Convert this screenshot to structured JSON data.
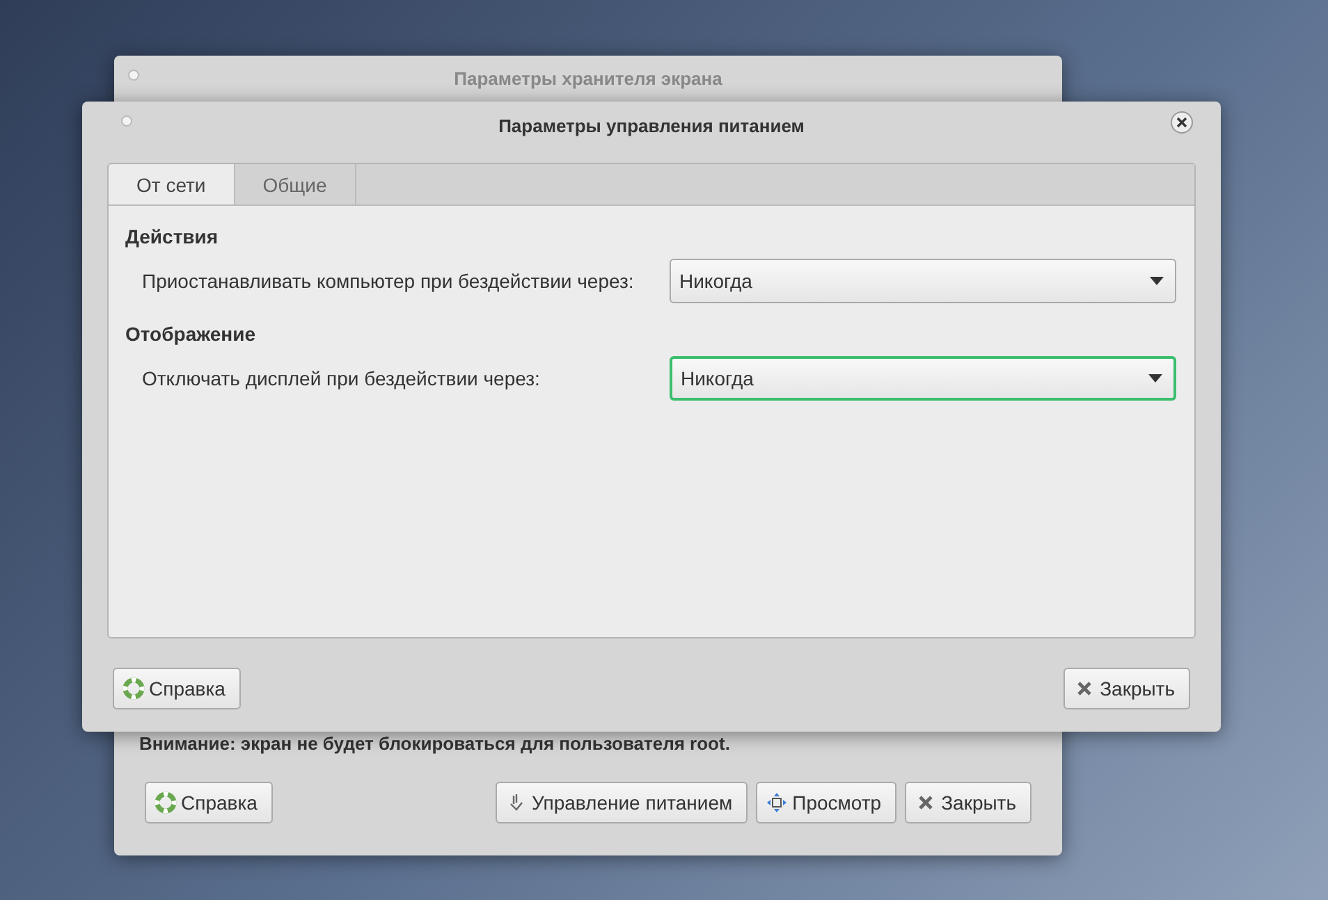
{
  "background_window": {
    "title": "Параметры хранителя экрана",
    "warning": "Внимание: экран не будет блокироваться для пользователя root.",
    "buttons": [
      {
        "label": "Справка",
        "kind": "help"
      },
      {
        "label": "Управление питанием",
        "kind": "power"
      },
      {
        "label": "Просмотр",
        "kind": "preview"
      },
      {
        "label": "Закрыть",
        "kind": "close"
      }
    ]
  },
  "window": {
    "title": "Параметры управления питанием",
    "tabs": [
      {
        "label": "От сети",
        "selected": true
      },
      {
        "label": "Общие",
        "selected": false
      }
    ],
    "sections": [
      {
        "heading": "Действия",
        "rows": [
          {
            "label": "Приостанавливать компьютер при бездействии через:",
            "value": "Никогда",
            "focused": false
          }
        ]
      },
      {
        "heading": "Отображение",
        "rows": [
          {
            "label": "Отключать дисплей при бездействии через:",
            "value": "Никогда",
            "focused": true
          }
        ]
      }
    ],
    "buttons": [
      {
        "label": "Справка",
        "kind": "help"
      },
      {
        "label": "Закрыть",
        "kind": "close"
      }
    ]
  }
}
